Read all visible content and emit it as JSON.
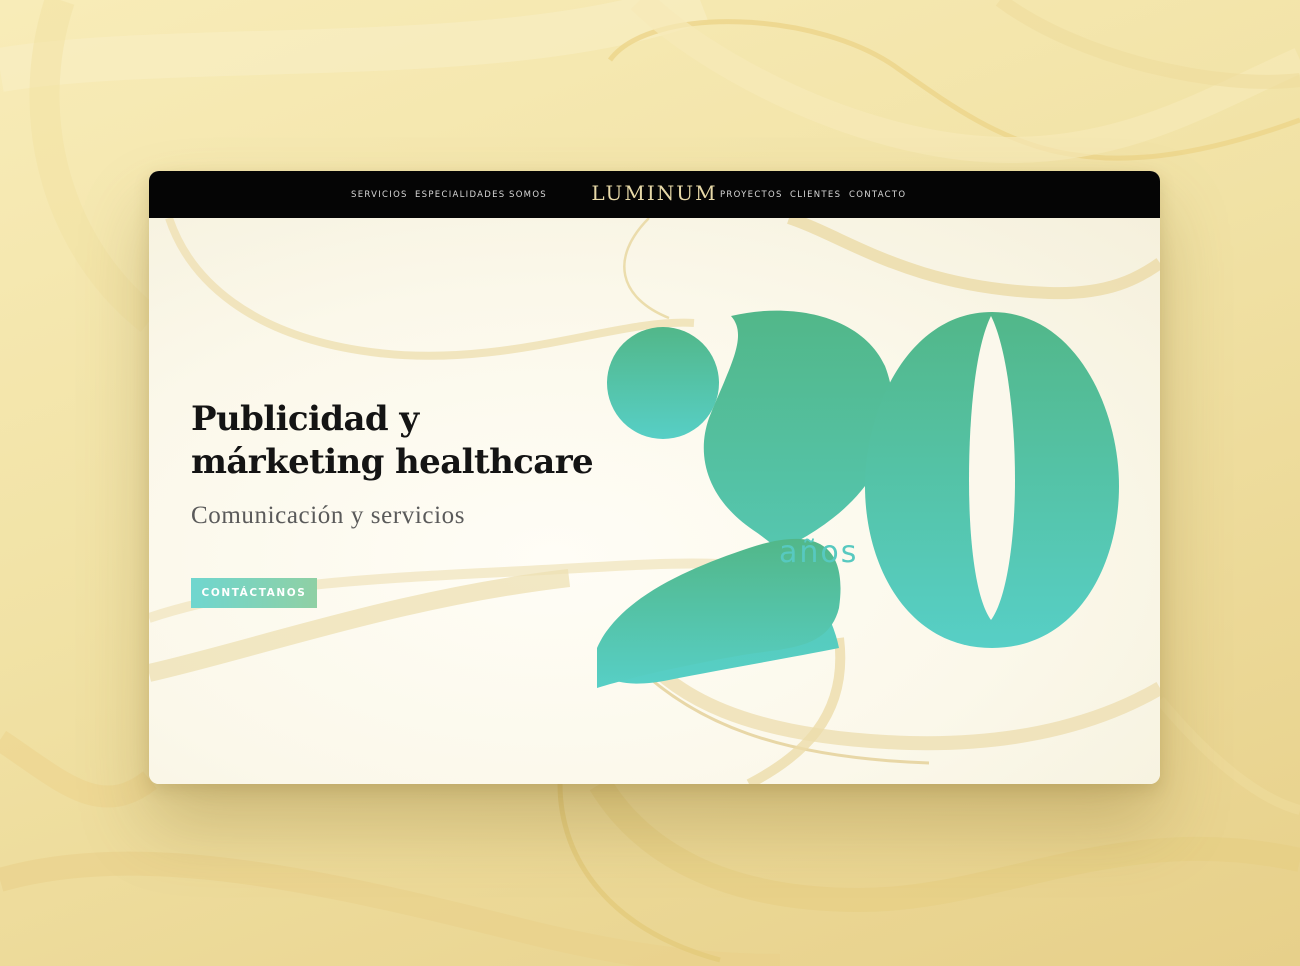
{
  "navbar": {
    "left_items": [
      "SERVICIOS",
      "ESPECIALIDADES",
      "SOMOS"
    ],
    "logo": "LUMINUM",
    "right_items": [
      "PROYECTOS",
      "CLIENTES",
      "CONTACTO"
    ]
  },
  "hero": {
    "headline_line1": "Publicidad y",
    "headline_line2": "márketing healthcare",
    "subtitle": "Comunicación y servicios",
    "cta_label": "CONTÁCTANOS",
    "anniversary_number": "20",
    "anniversary_label": "años"
  },
  "colors": {
    "page_background": "#f3e5aa",
    "nav_background": "#050505",
    "logo_gold": "#e7d9a8",
    "accent_green": "#52b789",
    "accent_teal": "#57cfc6",
    "ribbon_gold": "#eeddae",
    "headline_text": "#141414",
    "subtitle_text": "#5a5a5a"
  }
}
